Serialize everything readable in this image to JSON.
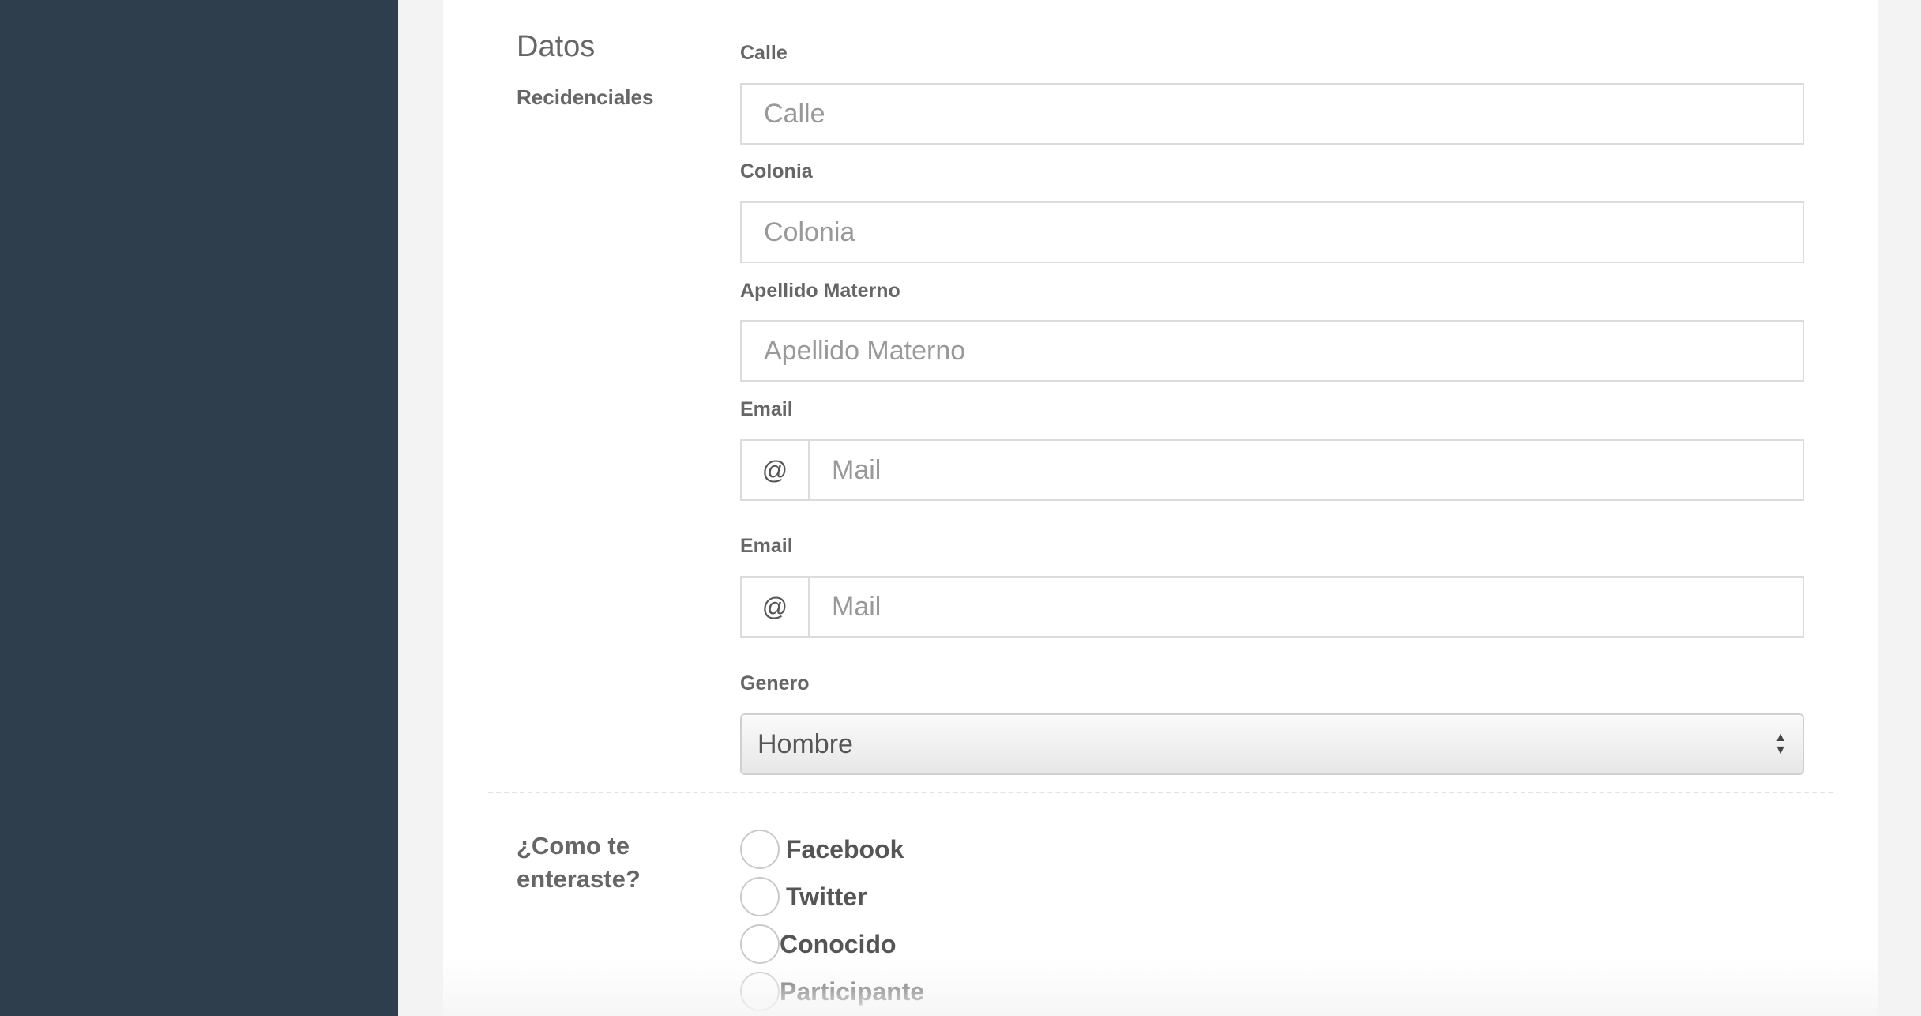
{
  "section": {
    "title": "Datos",
    "subtitle": "Recidenciales"
  },
  "fields": {
    "calle": {
      "label": "Calle",
      "placeholder": "Calle"
    },
    "colonia": {
      "label": "Colonia",
      "placeholder": "Colonia"
    },
    "apellido_materno": {
      "label": "Apellido Materno",
      "placeholder": "Apellido Materno"
    },
    "email1": {
      "label": "Email",
      "addon": "@",
      "placeholder": "Mail"
    },
    "email2": {
      "label": "Email",
      "addon": "@",
      "placeholder": "Mail"
    },
    "genero": {
      "label": "Genero",
      "value": "Hombre"
    }
  },
  "how_found": {
    "question": "¿Como te enteraste?",
    "options": [
      "Facebook",
      "Twitter",
      "Conocido",
      "Participante"
    ]
  },
  "colors": {
    "sidebar": "#2f3e4d",
    "background": "#f3f3f3",
    "card": "#ffffff"
  }
}
